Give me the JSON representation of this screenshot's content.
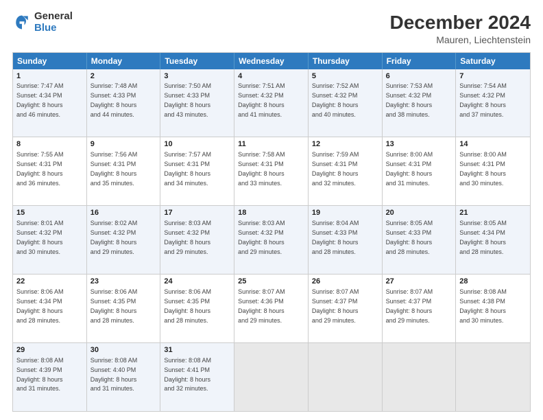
{
  "header": {
    "logo_general": "General",
    "logo_blue": "Blue",
    "main_title": "December 2024",
    "subtitle": "Mauren, Liechtenstein"
  },
  "days_of_week": [
    "Sunday",
    "Monday",
    "Tuesday",
    "Wednesday",
    "Thursday",
    "Friday",
    "Saturday"
  ],
  "weeks": [
    [
      {
        "day": "1",
        "lines": [
          "Sunrise: 7:47 AM",
          "Sunset: 4:34 PM",
          "Daylight: 8 hours",
          "and 46 minutes."
        ]
      },
      {
        "day": "2",
        "lines": [
          "Sunrise: 7:48 AM",
          "Sunset: 4:33 PM",
          "Daylight: 8 hours",
          "and 44 minutes."
        ]
      },
      {
        "day": "3",
        "lines": [
          "Sunrise: 7:50 AM",
          "Sunset: 4:33 PM",
          "Daylight: 8 hours",
          "and 43 minutes."
        ]
      },
      {
        "day": "4",
        "lines": [
          "Sunrise: 7:51 AM",
          "Sunset: 4:32 PM",
          "Daylight: 8 hours",
          "and 41 minutes."
        ]
      },
      {
        "day": "5",
        "lines": [
          "Sunrise: 7:52 AM",
          "Sunset: 4:32 PM",
          "Daylight: 8 hours",
          "and 40 minutes."
        ]
      },
      {
        "day": "6",
        "lines": [
          "Sunrise: 7:53 AM",
          "Sunset: 4:32 PM",
          "Daylight: 8 hours",
          "and 38 minutes."
        ]
      },
      {
        "day": "7",
        "lines": [
          "Sunrise: 7:54 AM",
          "Sunset: 4:32 PM",
          "Daylight: 8 hours",
          "and 37 minutes."
        ]
      }
    ],
    [
      {
        "day": "8",
        "lines": [
          "Sunrise: 7:55 AM",
          "Sunset: 4:31 PM",
          "Daylight: 8 hours",
          "and 36 minutes."
        ]
      },
      {
        "day": "9",
        "lines": [
          "Sunrise: 7:56 AM",
          "Sunset: 4:31 PM",
          "Daylight: 8 hours",
          "and 35 minutes."
        ]
      },
      {
        "day": "10",
        "lines": [
          "Sunrise: 7:57 AM",
          "Sunset: 4:31 PM",
          "Daylight: 8 hours",
          "and 34 minutes."
        ]
      },
      {
        "day": "11",
        "lines": [
          "Sunrise: 7:58 AM",
          "Sunset: 4:31 PM",
          "Daylight: 8 hours",
          "and 33 minutes."
        ]
      },
      {
        "day": "12",
        "lines": [
          "Sunrise: 7:59 AM",
          "Sunset: 4:31 PM",
          "Daylight: 8 hours",
          "and 32 minutes."
        ]
      },
      {
        "day": "13",
        "lines": [
          "Sunrise: 8:00 AM",
          "Sunset: 4:31 PM",
          "Daylight: 8 hours",
          "and 31 minutes."
        ]
      },
      {
        "day": "14",
        "lines": [
          "Sunrise: 8:00 AM",
          "Sunset: 4:31 PM",
          "Daylight: 8 hours",
          "and 30 minutes."
        ]
      }
    ],
    [
      {
        "day": "15",
        "lines": [
          "Sunrise: 8:01 AM",
          "Sunset: 4:32 PM",
          "Daylight: 8 hours",
          "and 30 minutes."
        ]
      },
      {
        "day": "16",
        "lines": [
          "Sunrise: 8:02 AM",
          "Sunset: 4:32 PM",
          "Daylight: 8 hours",
          "and 29 minutes."
        ]
      },
      {
        "day": "17",
        "lines": [
          "Sunrise: 8:03 AM",
          "Sunset: 4:32 PM",
          "Daylight: 8 hours",
          "and 29 minutes."
        ]
      },
      {
        "day": "18",
        "lines": [
          "Sunrise: 8:03 AM",
          "Sunset: 4:32 PM",
          "Daylight: 8 hours",
          "and 29 minutes."
        ]
      },
      {
        "day": "19",
        "lines": [
          "Sunrise: 8:04 AM",
          "Sunset: 4:33 PM",
          "Daylight: 8 hours",
          "and 28 minutes."
        ]
      },
      {
        "day": "20",
        "lines": [
          "Sunrise: 8:05 AM",
          "Sunset: 4:33 PM",
          "Daylight: 8 hours",
          "and 28 minutes."
        ]
      },
      {
        "day": "21",
        "lines": [
          "Sunrise: 8:05 AM",
          "Sunset: 4:34 PM",
          "Daylight: 8 hours",
          "and 28 minutes."
        ]
      }
    ],
    [
      {
        "day": "22",
        "lines": [
          "Sunrise: 8:06 AM",
          "Sunset: 4:34 PM",
          "Daylight: 8 hours",
          "and 28 minutes."
        ]
      },
      {
        "day": "23",
        "lines": [
          "Sunrise: 8:06 AM",
          "Sunset: 4:35 PM",
          "Daylight: 8 hours",
          "and 28 minutes."
        ]
      },
      {
        "day": "24",
        "lines": [
          "Sunrise: 8:06 AM",
          "Sunset: 4:35 PM",
          "Daylight: 8 hours",
          "and 28 minutes."
        ]
      },
      {
        "day": "25",
        "lines": [
          "Sunrise: 8:07 AM",
          "Sunset: 4:36 PM",
          "Daylight: 8 hours",
          "and 29 minutes."
        ]
      },
      {
        "day": "26",
        "lines": [
          "Sunrise: 8:07 AM",
          "Sunset: 4:37 PM",
          "Daylight: 8 hours",
          "and 29 minutes."
        ]
      },
      {
        "day": "27",
        "lines": [
          "Sunrise: 8:07 AM",
          "Sunset: 4:37 PM",
          "Daylight: 8 hours",
          "and 29 minutes."
        ]
      },
      {
        "day": "28",
        "lines": [
          "Sunrise: 8:08 AM",
          "Sunset: 4:38 PM",
          "Daylight: 8 hours",
          "and 30 minutes."
        ]
      }
    ],
    [
      {
        "day": "29",
        "lines": [
          "Sunrise: 8:08 AM",
          "Sunset: 4:39 PM",
          "Daylight: 8 hours",
          "and 31 minutes."
        ]
      },
      {
        "day": "30",
        "lines": [
          "Sunrise: 8:08 AM",
          "Sunset: 4:40 PM",
          "Daylight: 8 hours",
          "and 31 minutes."
        ]
      },
      {
        "day": "31",
        "lines": [
          "Sunrise: 8:08 AM",
          "Sunset: 4:41 PM",
          "Daylight: 8 hours",
          "and 32 minutes."
        ]
      },
      {
        "day": "",
        "lines": []
      },
      {
        "day": "",
        "lines": []
      },
      {
        "day": "",
        "lines": []
      },
      {
        "day": "",
        "lines": []
      }
    ]
  ]
}
